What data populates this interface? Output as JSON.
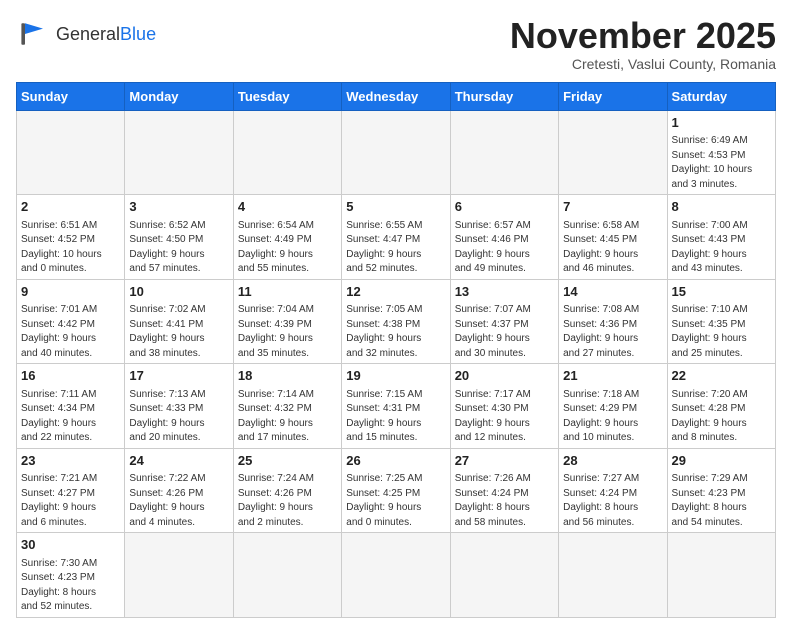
{
  "header": {
    "logo_general": "General",
    "logo_blue": "Blue",
    "month": "November 2025",
    "location": "Cretesti, Vaslui County, Romania"
  },
  "weekdays": [
    "Sunday",
    "Monday",
    "Tuesday",
    "Wednesday",
    "Thursday",
    "Friday",
    "Saturday"
  ],
  "weeks": [
    [
      {
        "day": "",
        "info": ""
      },
      {
        "day": "",
        "info": ""
      },
      {
        "day": "",
        "info": ""
      },
      {
        "day": "",
        "info": ""
      },
      {
        "day": "",
        "info": ""
      },
      {
        "day": "",
        "info": ""
      },
      {
        "day": "1",
        "info": "Sunrise: 6:49 AM\nSunset: 4:53 PM\nDaylight: 10 hours\nand 3 minutes."
      }
    ],
    [
      {
        "day": "2",
        "info": "Sunrise: 6:51 AM\nSunset: 4:52 PM\nDaylight: 10 hours\nand 0 minutes."
      },
      {
        "day": "3",
        "info": "Sunrise: 6:52 AM\nSunset: 4:50 PM\nDaylight: 9 hours\nand 57 minutes."
      },
      {
        "day": "4",
        "info": "Sunrise: 6:54 AM\nSunset: 4:49 PM\nDaylight: 9 hours\nand 55 minutes."
      },
      {
        "day": "5",
        "info": "Sunrise: 6:55 AM\nSunset: 4:47 PM\nDaylight: 9 hours\nand 52 minutes."
      },
      {
        "day": "6",
        "info": "Sunrise: 6:57 AM\nSunset: 4:46 PM\nDaylight: 9 hours\nand 49 minutes."
      },
      {
        "day": "7",
        "info": "Sunrise: 6:58 AM\nSunset: 4:45 PM\nDaylight: 9 hours\nand 46 minutes."
      },
      {
        "day": "8",
        "info": "Sunrise: 7:00 AM\nSunset: 4:43 PM\nDaylight: 9 hours\nand 43 minutes."
      }
    ],
    [
      {
        "day": "9",
        "info": "Sunrise: 7:01 AM\nSunset: 4:42 PM\nDaylight: 9 hours\nand 40 minutes."
      },
      {
        "day": "10",
        "info": "Sunrise: 7:02 AM\nSunset: 4:41 PM\nDaylight: 9 hours\nand 38 minutes."
      },
      {
        "day": "11",
        "info": "Sunrise: 7:04 AM\nSunset: 4:39 PM\nDaylight: 9 hours\nand 35 minutes."
      },
      {
        "day": "12",
        "info": "Sunrise: 7:05 AM\nSunset: 4:38 PM\nDaylight: 9 hours\nand 32 minutes."
      },
      {
        "day": "13",
        "info": "Sunrise: 7:07 AM\nSunset: 4:37 PM\nDaylight: 9 hours\nand 30 minutes."
      },
      {
        "day": "14",
        "info": "Sunrise: 7:08 AM\nSunset: 4:36 PM\nDaylight: 9 hours\nand 27 minutes."
      },
      {
        "day": "15",
        "info": "Sunrise: 7:10 AM\nSunset: 4:35 PM\nDaylight: 9 hours\nand 25 minutes."
      }
    ],
    [
      {
        "day": "16",
        "info": "Sunrise: 7:11 AM\nSunset: 4:34 PM\nDaylight: 9 hours\nand 22 minutes."
      },
      {
        "day": "17",
        "info": "Sunrise: 7:13 AM\nSunset: 4:33 PM\nDaylight: 9 hours\nand 20 minutes."
      },
      {
        "day": "18",
        "info": "Sunrise: 7:14 AM\nSunset: 4:32 PM\nDaylight: 9 hours\nand 17 minutes."
      },
      {
        "day": "19",
        "info": "Sunrise: 7:15 AM\nSunset: 4:31 PM\nDaylight: 9 hours\nand 15 minutes."
      },
      {
        "day": "20",
        "info": "Sunrise: 7:17 AM\nSunset: 4:30 PM\nDaylight: 9 hours\nand 12 minutes."
      },
      {
        "day": "21",
        "info": "Sunrise: 7:18 AM\nSunset: 4:29 PM\nDaylight: 9 hours\nand 10 minutes."
      },
      {
        "day": "22",
        "info": "Sunrise: 7:20 AM\nSunset: 4:28 PM\nDaylight: 9 hours\nand 8 minutes."
      }
    ],
    [
      {
        "day": "23",
        "info": "Sunrise: 7:21 AM\nSunset: 4:27 PM\nDaylight: 9 hours\nand 6 minutes."
      },
      {
        "day": "24",
        "info": "Sunrise: 7:22 AM\nSunset: 4:26 PM\nDaylight: 9 hours\nand 4 minutes."
      },
      {
        "day": "25",
        "info": "Sunrise: 7:24 AM\nSunset: 4:26 PM\nDaylight: 9 hours\nand 2 minutes."
      },
      {
        "day": "26",
        "info": "Sunrise: 7:25 AM\nSunset: 4:25 PM\nDaylight: 9 hours\nand 0 minutes."
      },
      {
        "day": "27",
        "info": "Sunrise: 7:26 AM\nSunset: 4:24 PM\nDaylight: 8 hours\nand 58 minutes."
      },
      {
        "day": "28",
        "info": "Sunrise: 7:27 AM\nSunset: 4:24 PM\nDaylight: 8 hours\nand 56 minutes."
      },
      {
        "day": "29",
        "info": "Sunrise: 7:29 AM\nSunset: 4:23 PM\nDaylight: 8 hours\nand 54 minutes."
      }
    ],
    [
      {
        "day": "30",
        "info": "Sunrise: 7:30 AM\nSunset: 4:23 PM\nDaylight: 8 hours\nand 52 minutes."
      },
      {
        "day": "",
        "info": ""
      },
      {
        "day": "",
        "info": ""
      },
      {
        "day": "",
        "info": ""
      },
      {
        "day": "",
        "info": ""
      },
      {
        "day": "",
        "info": ""
      },
      {
        "day": "",
        "info": ""
      }
    ]
  ]
}
